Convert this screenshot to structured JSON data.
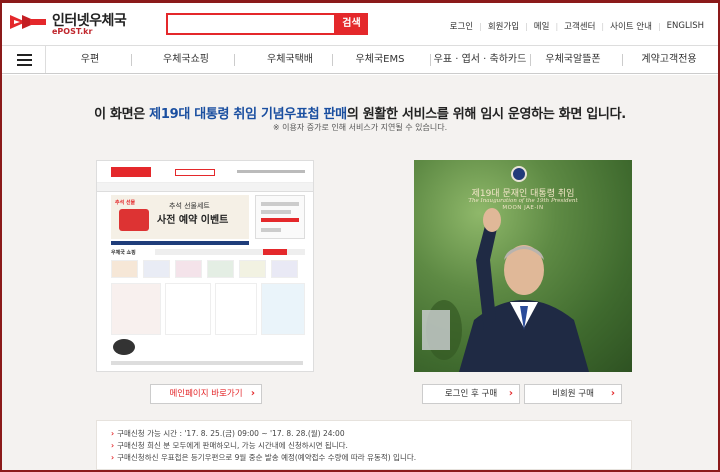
{
  "brand": {
    "title": "인터넷우체국",
    "subtitle": "ePOST.kr",
    "accent_color": "#e4282b"
  },
  "search": {
    "placeholder": "",
    "button_label": "검색"
  },
  "util_links": [
    "로그인",
    "회원가입",
    "메일",
    "고객센터",
    "사이트 안내",
    "ENGLISH"
  ],
  "nav": {
    "menu_icon": "hamburger-icon",
    "items": [
      "우편",
      "우체국쇼핑",
      "우체국택배",
      "우체국EMS",
      "우표 · 엽서 · 축하카드",
      "우체국알뜰폰",
      "계약고객전용"
    ]
  },
  "notice": {
    "headline_pre": "이 화면은 ",
    "headline_highlight": "제19대 대통령 취임 기념우표첩 판매",
    "headline_post": "의 원활한 서비스를 위해 임시 운영하는 화면 입니다.",
    "subnote": "※ 이용자 증가로 인해 서비스가 지연될 수 있습니다."
  },
  "thumbnail": {
    "banner_tag": "추석 선물",
    "banner_line1": "추석 선물세트",
    "banner_line2": "사전 예약 이벤트",
    "section_label": "우체국 쇼핑"
  },
  "photo": {
    "title_ko": "제19대 문재인 대통령 취임",
    "title_en": "The Inauguration of the 19th President",
    "name_en": "MOON JAE-IN"
  },
  "buttons": {
    "main_page": "메인페이지 바로가기",
    "buy_login": "로그인 후 구매",
    "buy_guest": "비회원 구매",
    "chevron": "›"
  },
  "notes": [
    "구매신청 가능 시간 : '17. 8. 25.(금) 09:00 ~ '17. 8. 28.(월) 24:00",
    "구매신청 희신 분 모두에게 판매하오니, 가능 시간내에 신청하시면 됩니다.",
    "구매신청하신 우표첩은 등기우편으로 9월 중순 발송 예정(예약접수 수량에 따라 유동적) 입니다."
  ]
}
